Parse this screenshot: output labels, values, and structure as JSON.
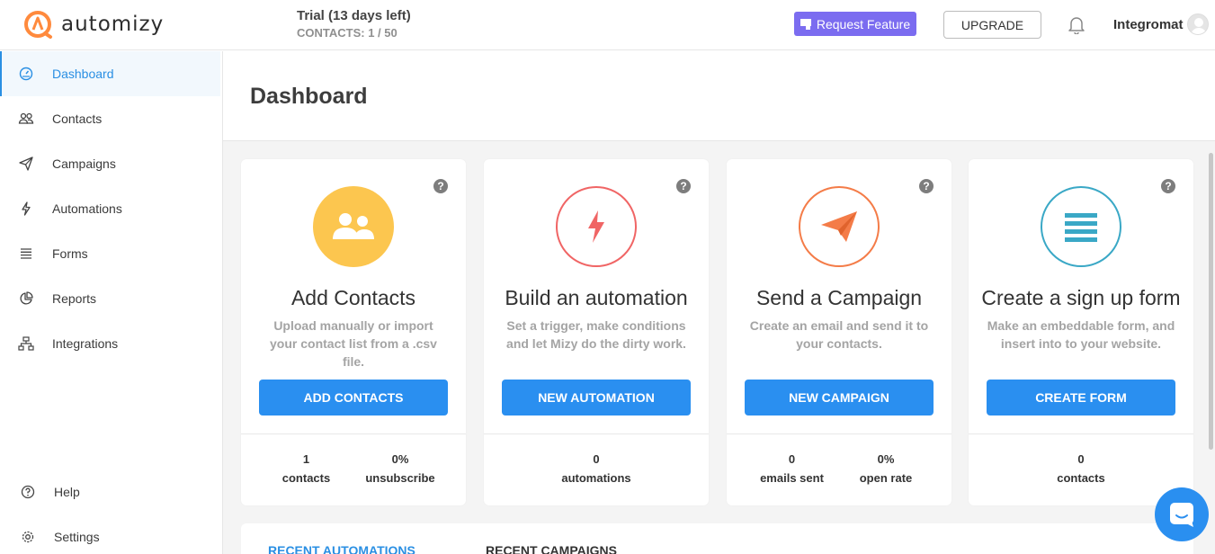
{
  "brand": {
    "name": "automizy",
    "accent": "#ff8a3d"
  },
  "header": {
    "trial_title": "Trial (13 days left)",
    "contacts_usage": "CONTACTS: 1 / 50",
    "request_feature_label": "Request Feature",
    "upgrade_label": "UPGRADE",
    "user_name": "Integromat"
  },
  "sidebar": {
    "items": [
      {
        "label": "Dashboard",
        "icon": "dashboard-icon",
        "active": true
      },
      {
        "label": "Contacts",
        "icon": "contacts-icon"
      },
      {
        "label": "Campaigns",
        "icon": "paper-plane-icon"
      },
      {
        "label": "Automations",
        "icon": "lightning-icon"
      },
      {
        "label": "Forms",
        "icon": "list-icon"
      },
      {
        "label": "Reports",
        "icon": "pie-chart-icon"
      },
      {
        "label": "Integrations",
        "icon": "sitemap-icon"
      }
    ],
    "help_label": "Help",
    "settings_label": "Settings"
  },
  "page": {
    "title": "Dashboard"
  },
  "cards": [
    {
      "title": "Add Contacts",
      "description": "Upload manually or import your contact list from a .csv file.",
      "button": "ADD CONTACTS",
      "icon": "users-icon",
      "color": "#fcc64f",
      "stats": [
        {
          "value": "1",
          "label": "contacts"
        },
        {
          "value": "0%",
          "label": "unsubscribe"
        }
      ]
    },
    {
      "title": "Build an automation",
      "description": "Set a trigger, make conditions and let Mizy do the dirty work.",
      "button": "NEW AUTOMATION",
      "icon": "lightning-icon",
      "color": "#f06565",
      "stats": [
        {
          "value": "0",
          "label": "automations"
        }
      ]
    },
    {
      "title": "Send a Campaign",
      "description": "Create an email and send it to your contacts.",
      "button": "NEW CAMPAIGN",
      "icon": "paper-plane-icon",
      "color": "#f47c48",
      "stats": [
        {
          "value": "0",
          "label": "emails sent"
        },
        {
          "value": "0%",
          "label": "open rate"
        }
      ]
    },
    {
      "title": "Create a sign up form",
      "description": "Make an embeddable form, and insert into to your website.",
      "button": "CREATE FORM",
      "icon": "list-icon",
      "color": "#3aa8c6",
      "stats": [
        {
          "value": "0",
          "label": "contacts"
        }
      ]
    }
  ],
  "tabs": {
    "recent_automations": "RECENT AUTOMATIONS",
    "recent_campaigns": "RECENT CAMPAIGNS"
  },
  "colors": {
    "primary": "#2a8ff0",
    "request_feature": "#7b6cf0"
  }
}
